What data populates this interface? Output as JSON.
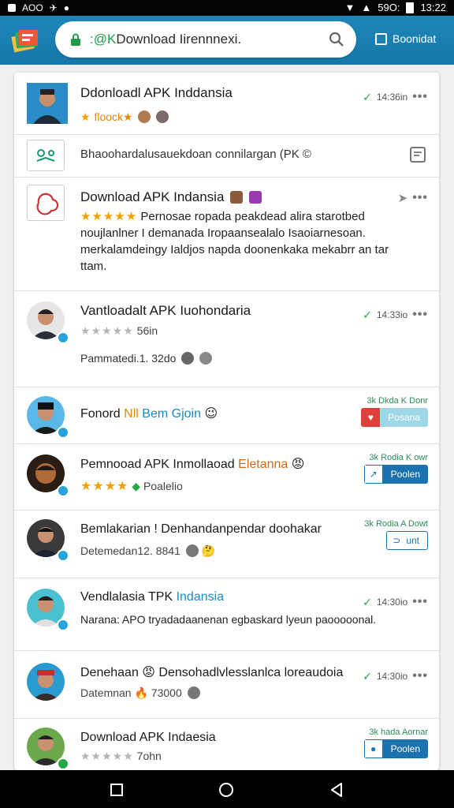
{
  "status": {
    "left_text": "AOO",
    "battery_text": "59O:",
    "time": "13:22"
  },
  "appbar": {
    "search_text_prefix": ":@K",
    "search_text": "Download Iirennnexi.",
    "bookmark_label": "Boonidat"
  },
  "items": [
    {
      "title": "Ddonloadl APK Inddansia",
      "sub_stars": "★",
      "sub_text": "floock★",
      "meta": "14:36in",
      "meta_tick": "✓",
      "dots": "•••"
    },
    {
      "text": "Bhaoohardalusauekdoan connilargan (PK ©"
    },
    {
      "title": "Download APK Indansia",
      "stars": "★★★★★",
      "desc_line1": "Pernosae ropada peakdead alira starotbed",
      "desc_rest": "noujlanlner I demanada Iropaansealalo Isaoiarnesoan. merkalamdeingy Ialdjos napda doonenkaka mekabrr an tar ttam.",
      "meta_icon": "➤",
      "dots": "•••"
    },
    {
      "title": "Vantloadalt APK Iuohondaria",
      "stars": "★★★★★",
      "sub_text": "56in",
      "footer": "Pammatedi.1. 32do",
      "meta": "14:33io",
      "meta_tick": "✓",
      "dots": "•••"
    },
    {
      "title_a": "Fonord",
      "title_b": "Nll",
      "title_c": "Bem Gjoin",
      "emoji": "😉",
      "side_label": "3k Dkda K Donr",
      "button_label": "Posana"
    },
    {
      "title_a": "Pemnooad APK Inmollaoad",
      "title_b": "Eletanna",
      "emoji": "😡",
      "stars": "★★★★",
      "sub_text": "Poalelio",
      "side_label": "3k Rodia K owr",
      "button_label": "Poolen"
    },
    {
      "title": "Bemlakarian ! Denhandanpendar doohakar",
      "sub_text": "Detemedan12. 8841",
      "emoji": "🤔",
      "side_label": "3k Rodia A Dowt",
      "button_label": "unt"
    },
    {
      "title_a": "Vendlalasia TPK",
      "title_b": "Indansia",
      "desc": "Narana: APO tryadadaanenan egbaskard lyeun paooooonal.",
      "meta": "14:30io",
      "meta_tick": "✓",
      "dots": "•••"
    },
    {
      "title": "Denehaan 😡 Densohadlvlesslanlca loreaudoia",
      "sub_text": "Datemnan 🔥 73000",
      "meta": "14:30io",
      "meta_tick": "✓",
      "dots": "•••"
    },
    {
      "title": "Download APK Indaesia",
      "stars": "★★★★★",
      "sub_text": "7ohn",
      "side_label": "3k hada Aornar",
      "button_label": "Poolen"
    }
  ],
  "colors": {
    "appbar": "#1678a8",
    "accent_green": "#28a745",
    "star": "#f2a100",
    "button_blue": "#1b72b0",
    "button_red": "#e0403a"
  }
}
